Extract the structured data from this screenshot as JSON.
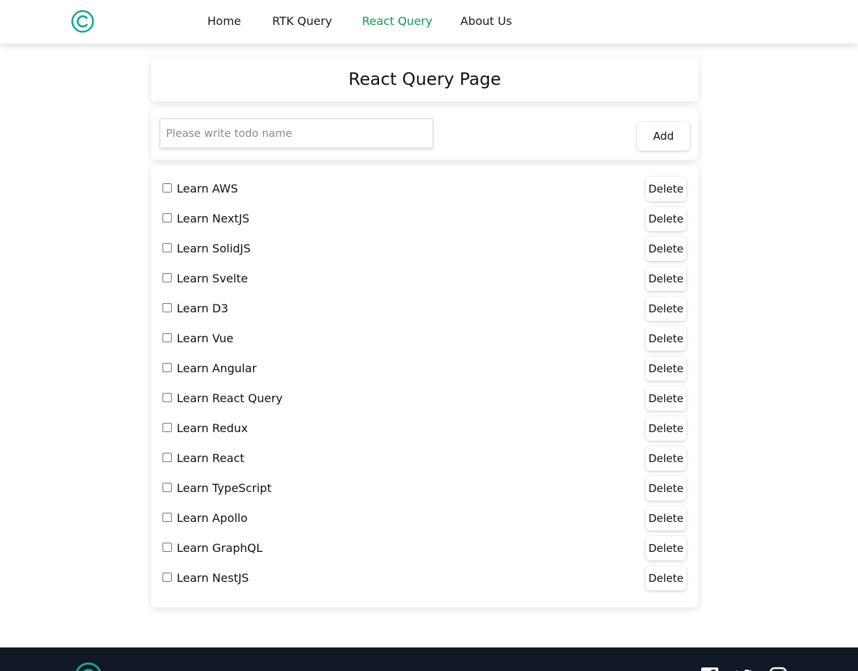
{
  "nav": {
    "links": [
      {
        "label": "Home"
      },
      {
        "label": "RTK Query"
      },
      {
        "label": "React Query",
        "active": true
      },
      {
        "label": "About Us"
      }
    ]
  },
  "page": {
    "title": "React Query Page"
  },
  "form": {
    "input_placeholder": "Please write todo name",
    "input_value": "",
    "add_label": "Add"
  },
  "todos": {
    "delete_label": "Delete",
    "items": [
      {
        "label": "Learn AWS",
        "completed": false
      },
      {
        "label": "Learn NextJS",
        "completed": false
      },
      {
        "label": "Learn SolidJS",
        "completed": false
      },
      {
        "label": "Learn Svelte",
        "completed": false
      },
      {
        "label": "Learn D3",
        "completed": false
      },
      {
        "label": "Learn Vue",
        "completed": false
      },
      {
        "label": "Learn Angular",
        "completed": false
      },
      {
        "label": "Learn React Query",
        "completed": false
      },
      {
        "label": "Learn Redux",
        "completed": false
      },
      {
        "label": "Learn React",
        "completed": false
      },
      {
        "label": "Learn TypeScript",
        "completed": false
      },
      {
        "label": "Learn Apollo",
        "completed": false
      },
      {
        "label": "Learn GraphQL",
        "completed": false
      },
      {
        "label": "Learn NestJS",
        "completed": false
      }
    ]
  },
  "icons": {
    "logo": "copyright-logo-icon",
    "footer_logo": "copyright-logo-icon",
    "social": [
      "facebook-icon",
      "twitter-icon",
      "instagram-icon"
    ]
  },
  "colors": {
    "brand_teal": "#14a98f",
    "active_link": "#0f9d4a",
    "footer_bg": "#121826"
  }
}
